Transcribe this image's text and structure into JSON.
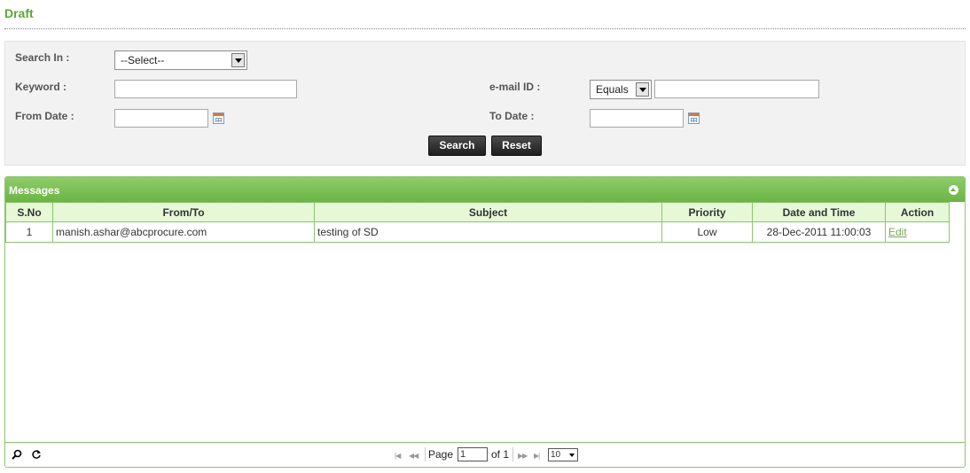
{
  "page": {
    "title": "Draft"
  },
  "search": {
    "search_in_label": "Search In :",
    "search_in_value": "--Select--",
    "keyword_label": "Keyword :",
    "keyword_value": "",
    "email_label": "e-mail ID :",
    "email_operator": "Equals",
    "email_value": "",
    "from_date_label": "From Date :",
    "from_date_value": "",
    "to_date_label": "To Date :",
    "to_date_value": "",
    "search_button": "Search",
    "reset_button": "Reset"
  },
  "messages": {
    "title": "Messages",
    "columns": [
      "S.No",
      "From/To",
      "Subject",
      "Priority",
      "Date and Time",
      "Action"
    ],
    "rows": [
      {
        "sno": "1",
        "from_to": "manish.ashar@abcprocure.com",
        "subject": "testing of SD",
        "priority": "Low",
        "datetime": "28-Dec-2011 11:00:03",
        "action": "Edit"
      }
    ]
  },
  "pager": {
    "page_label": "Page",
    "page_value": "1",
    "of_label": "of 1",
    "page_size": "10"
  },
  "colors": {
    "accent_green": "#6bb444",
    "title_green": "#5fa538",
    "header_row_bg": "#e6f8d6"
  },
  "icons": [
    "calendar-icon",
    "collapse-icon",
    "search-icon",
    "refresh-icon",
    "first-page-icon",
    "prev-page-icon",
    "next-page-icon",
    "last-page-icon"
  ]
}
